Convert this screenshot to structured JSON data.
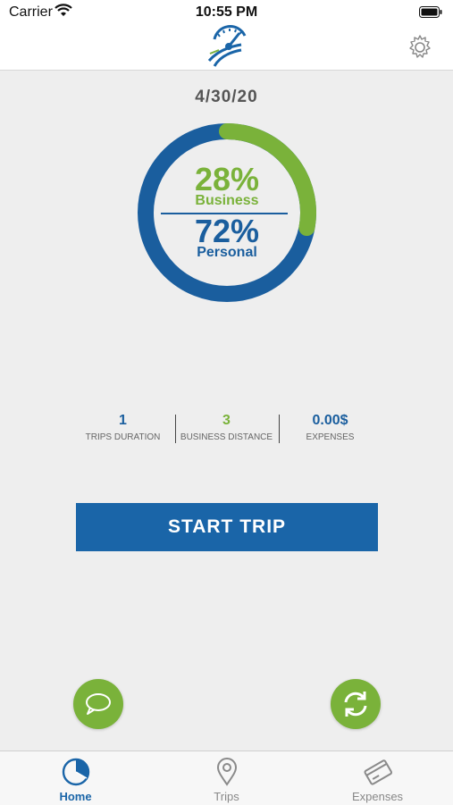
{
  "status_bar": {
    "carrier": "Carrier",
    "time": "10:55 PM"
  },
  "header": {
    "logo_icon": "speedometer-road-logo",
    "settings_icon": "gear-icon"
  },
  "date": "4/30/20",
  "summary": {
    "business_percent": "28%",
    "business_label": "Business",
    "personal_percent": "72%",
    "personal_label": "Personal",
    "business_fraction": 0.28
  },
  "stats": [
    {
      "value": "1",
      "label": "TRIPS DURATION"
    },
    {
      "value": "3",
      "label": "BUSINESS DISTANCE"
    },
    {
      "value": "0.00$",
      "label": "EXPENSES"
    }
  ],
  "start_button_label": "START TRIP",
  "tabs": [
    {
      "label": "Home",
      "icon": "pie-chart-icon",
      "active": true
    },
    {
      "label": "Trips",
      "icon": "map-pin-icon",
      "active": false
    },
    {
      "label": "Expenses",
      "icon": "credit-card-icon",
      "active": false
    }
  ],
  "colors": {
    "business": "#7ab23a",
    "personal": "#1a5e9e",
    "primary": "#1a65a8"
  }
}
